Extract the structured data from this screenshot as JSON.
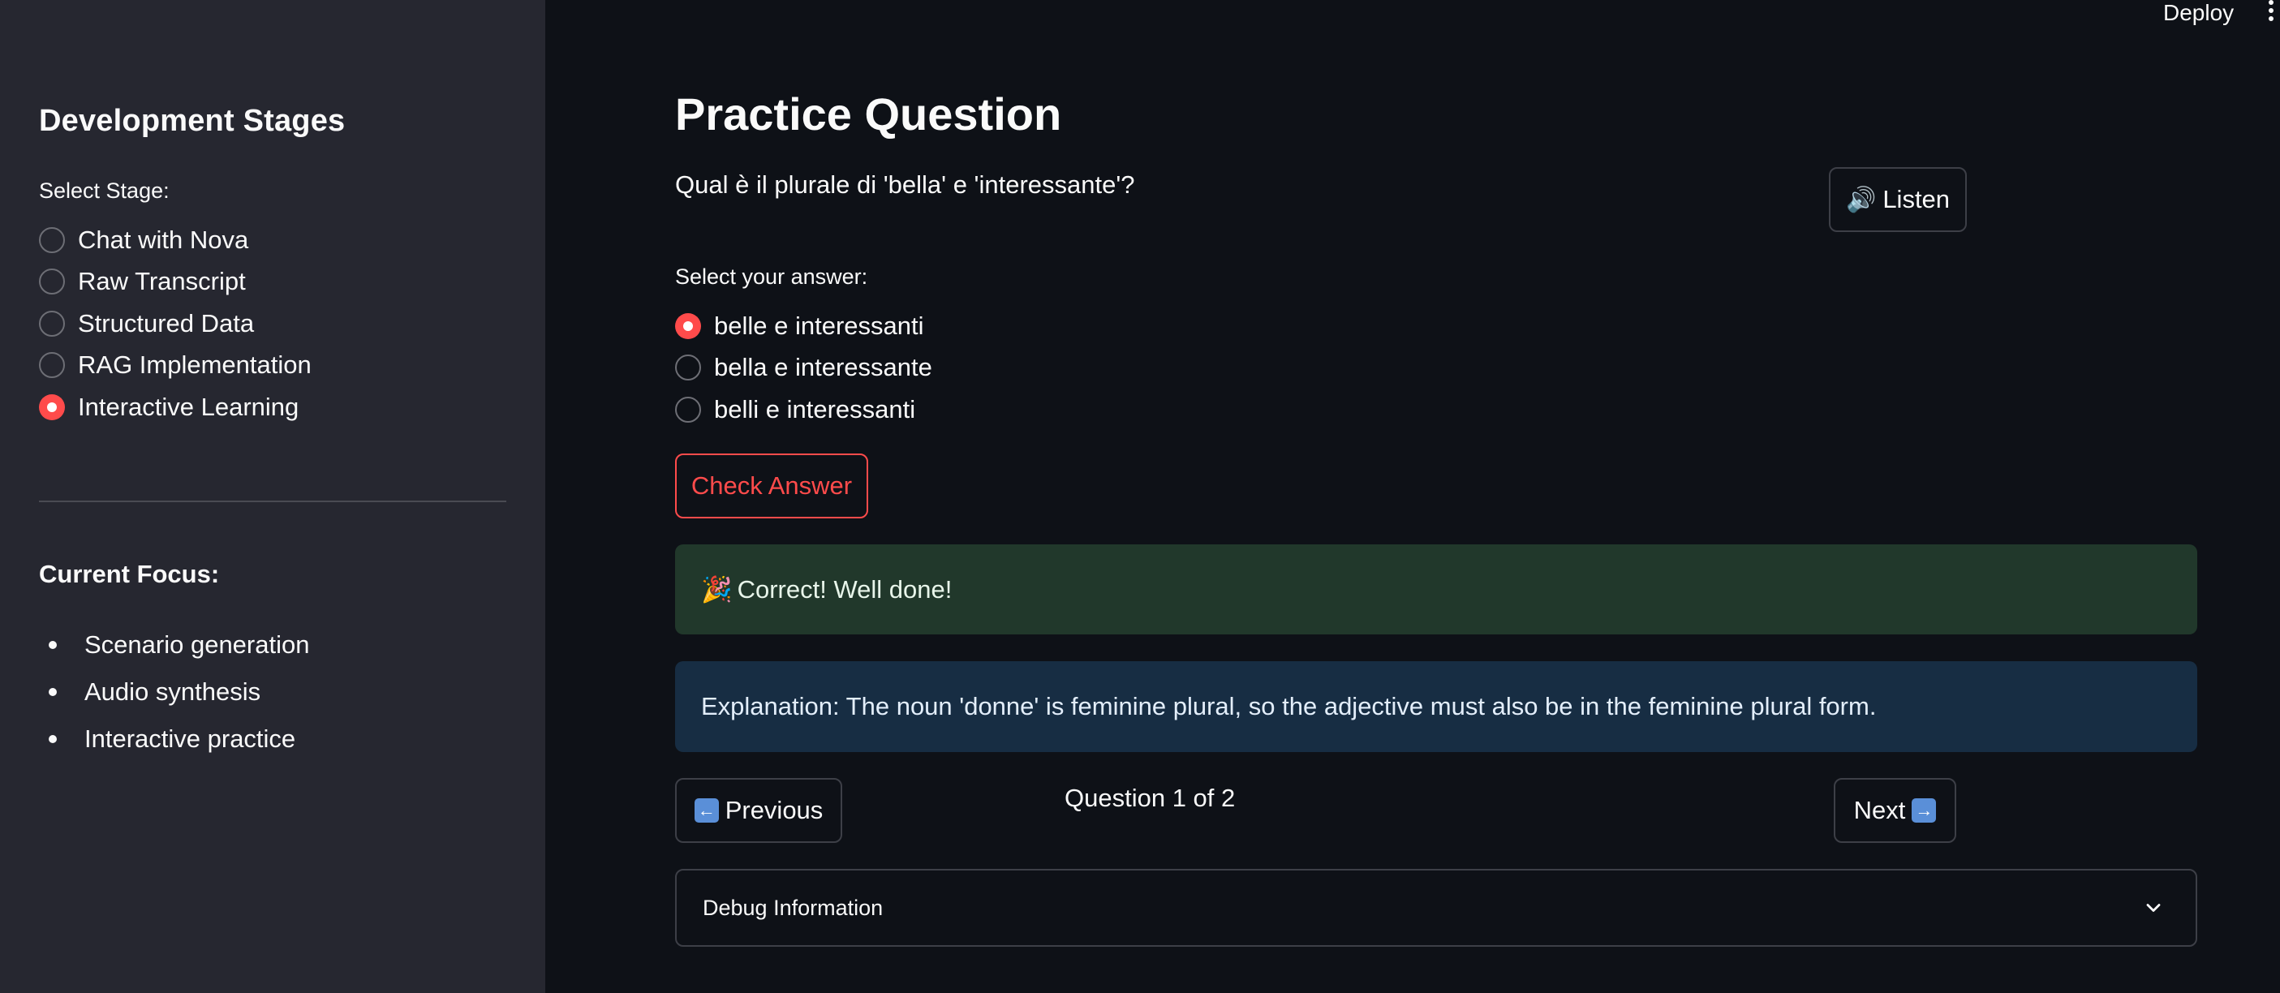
{
  "header": {
    "deploy_label": "Deploy"
  },
  "sidebar": {
    "title": "Development Stages",
    "select_label": "Select Stage:",
    "stages": [
      {
        "label": "Chat with Nova",
        "selected": false
      },
      {
        "label": "Raw Transcript",
        "selected": false
      },
      {
        "label": "Structured Data",
        "selected": false
      },
      {
        "label": "RAG Implementation",
        "selected": false
      },
      {
        "label": "Interactive Learning",
        "selected": true
      }
    ],
    "focus_title": "Current Focus:",
    "focus_items": [
      "Scenario generation",
      "Audio synthesis",
      "Interactive practice"
    ]
  },
  "main": {
    "title": "Practice Question",
    "question": "Qual è il plurale di 'bella' e 'interessante'?",
    "listen_icon": "🔊",
    "listen_label": "Listen",
    "answer_label": "Select your answer:",
    "answers": [
      {
        "label": "belle e interessanti",
        "selected": true
      },
      {
        "label": "bella e interessante",
        "selected": false
      },
      {
        "label": "belli e interessanti",
        "selected": false
      }
    ],
    "check_label": "Check Answer",
    "success_icon": "🎉",
    "success_text": "Correct! Well done!",
    "explanation": "Explanation: The noun 'donne' is feminine plural, so the adjective must also be in the feminine plural form.",
    "prev_label": "Previous",
    "next_label": "Next",
    "counter": "Question 1 of 2",
    "debug_title": "Debug Information"
  },
  "colors": {
    "accent": "#ff4b4b",
    "background": "#0e1117",
    "sidebar": "#262730",
    "success_bg": "#21382b",
    "info_bg": "#172d43"
  },
  "icons": {
    "listen": "speaker-icon",
    "success": "party-popper-icon",
    "prev": "left-arrow-icon",
    "next": "right-arrow-icon",
    "expander": "chevron-down-icon",
    "menu": "kebab-menu-icon"
  }
}
